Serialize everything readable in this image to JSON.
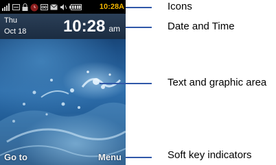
{
  "status_bar": {
    "icons": [
      "signal-icon",
      "network-icon",
      "lock-icon",
      "alarm-icon",
      "voicemail-icon",
      "message-icon",
      "speaker-muted-icon",
      "battery-icon"
    ],
    "time": "10:28A",
    "time_color": "#f1b500"
  },
  "date_bar": {
    "day": "Thu",
    "date": "Oct 18",
    "time": "10:28",
    "ampm": "am"
  },
  "softkeys": {
    "left": "Go to",
    "right": "Menu"
  },
  "callouts": {
    "icons": "Icons",
    "date_time": "Date and Time",
    "text_graphic": "Text and graphic area",
    "soft_keys": "Soft key indicators",
    "leader_color": "#2f57a8"
  }
}
